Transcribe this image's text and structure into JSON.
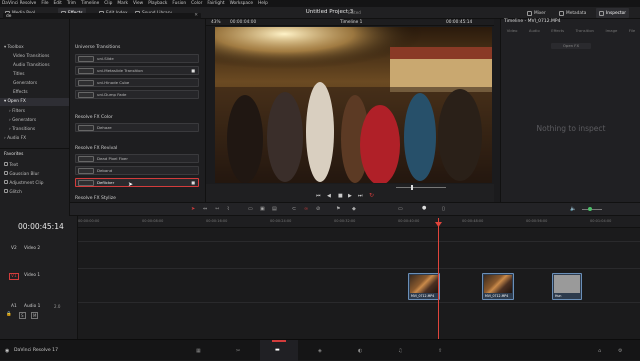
{
  "menubar": {
    "items": [
      "DaVinci Resolve",
      "File",
      "Edit",
      "Trim",
      "Timeline",
      "Clip",
      "Mark",
      "View",
      "Playback",
      "Fusion",
      "Color",
      "Fairlight",
      "Workspace",
      "Help"
    ]
  },
  "toolbar": {
    "media_pool": "Media Pool",
    "effects": "Effects",
    "edit_index": "Edit Index",
    "sound_library": "Sound Library",
    "project_title": "Untitled Project 3",
    "project_status": "Edited",
    "mixer": "Mixer",
    "metadata": "Metadata",
    "inspector": "Inspector"
  },
  "left_panel": {
    "items": [
      {
        "label": "Toolbox",
        "level": 0
      },
      {
        "label": "Video Transitions",
        "level": 1
      },
      {
        "label": "Audio Transitions",
        "level": 1
      },
      {
        "label": "Titles",
        "level": 1
      },
      {
        "label": "Generators",
        "level": 1
      },
      {
        "label": "Effects",
        "level": 1
      },
      {
        "label": "Open FX",
        "level": 0
      },
      {
        "label": "Filters",
        "level": 1
      },
      {
        "label": "Generators",
        "level": 1
      },
      {
        "label": "Transitions",
        "level": 1
      },
      {
        "label": "Audio FX",
        "level": 0
      }
    ],
    "favorites_header": "Favorites",
    "favorites": [
      "Text",
      "Gaussian Blur",
      "Adjustment Clip",
      "Glitch"
    ]
  },
  "search": {
    "value": "de"
  },
  "effects_list": {
    "groups": [
      {
        "title": "Universe Transitions",
        "items": [
          "uni.Slide",
          "uni.Metaslide Transition",
          "uni.Hinode Cube",
          "uni.Dump Fade"
        ]
      },
      {
        "title": "Resolve FX Color",
        "items": [
          "Dehaze"
        ]
      },
      {
        "title": "Resolve FX Revival",
        "items": [
          "Dead Pixel Fixer",
          "Deband",
          "Deflicker"
        ]
      },
      {
        "title": "Resolve FX Stylize",
        "items": []
      }
    ],
    "selected": "Deflicker"
  },
  "viewer": {
    "zoom": "43%",
    "source_tc": "00:00:04:00",
    "timeline_name": "Timeline 1",
    "record_tc": "00:00:45:14"
  },
  "inspector": {
    "header": "Timeline - MVI_0712.MP4",
    "tabs": [
      "Video",
      "Audio",
      "Effects",
      "Transition",
      "Image",
      "File"
    ],
    "subtabs": [
      "Open FX"
    ],
    "empty_text": "Nothing to inspect"
  },
  "timeline": {
    "timecode": "00:00:45:14",
    "ruler": [
      "00:00:00:00",
      "00:00:08:00",
      "00:00:16:00",
      "00:00:24:00",
      "00:00:32:00",
      "00:00:40:00",
      "00:00:48:00",
      "00:00:56:00",
      "00:01:04:00",
      "00:01:12:00",
      "00:01:20:00"
    ],
    "tracks": [
      {
        "id": "V2",
        "name": "Video 2"
      },
      {
        "id": "V1",
        "name": "Video 1"
      },
      {
        "id": "A1",
        "name": "Audio 1",
        "level": "2.0"
      }
    ],
    "clips": [
      "MVI_0712.MP4",
      "MVI_0712.MP4",
      "Hun"
    ]
  },
  "status": {
    "app": "DaVinci Resolve 17"
  },
  "colors": {
    "accent_red": "#d33c3c",
    "playhead": "#e0453c",
    "clip_blue": "#2d3b4d"
  }
}
